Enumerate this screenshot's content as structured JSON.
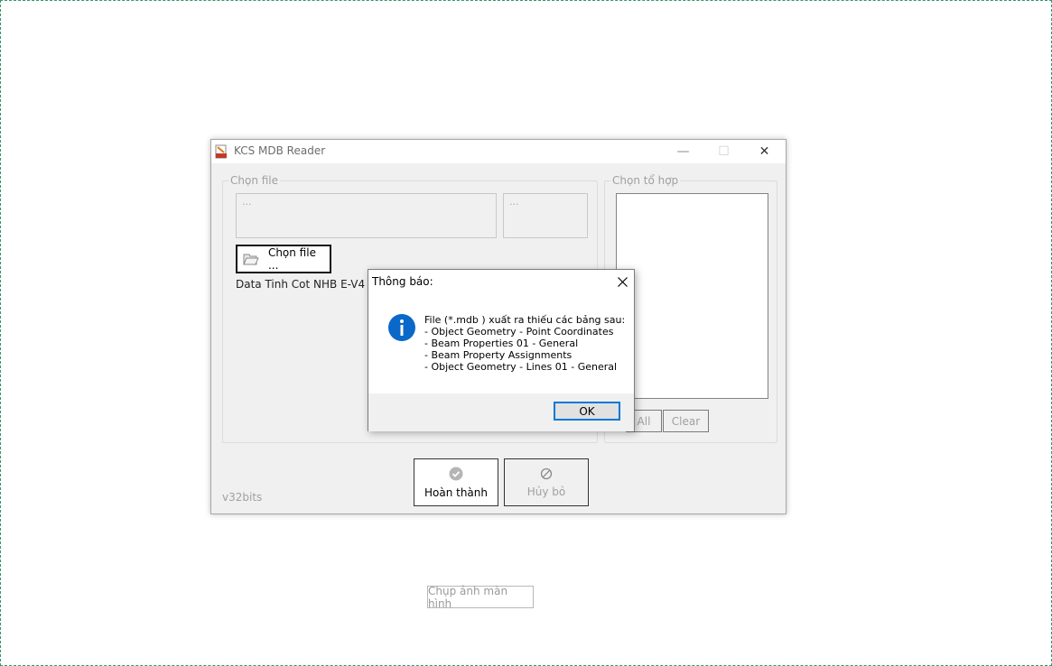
{
  "window": {
    "title": "KCS MDB Reader",
    "min_glyph": "—",
    "max_glyph": "☐",
    "close_glyph": "✕"
  },
  "file_group": {
    "label": "Chọn file",
    "path_placeholder": "...",
    "ext_placeholder": "...",
    "choose_button": "Chọn file ...",
    "data_text": "Data Tinh Cot NHB E-V4 23"
  },
  "combo_group": {
    "label": "Chọn tổ hợp",
    "all_button": "All",
    "clear_button": "Clear"
  },
  "footer": {
    "version": "v32bits",
    "done_button": "Hoàn thành",
    "cancel_button": "Hủy bỏ"
  },
  "message_box": {
    "title": "Thông báo:",
    "lines": [
      "File (*.mdb ) xuất ra thiếu các bảng sau:",
      "- Object Geometry - Point Coordinates",
      "- Beam Properties 01 - General",
      "- Beam Property Assignments",
      "- Object Geometry - Lines 01 - General"
    ],
    "ok_button": "OK",
    "icon": "info-icon"
  },
  "screenshot_button": "Chụp ảnh màn hình",
  "colors": {
    "accent": "#0078d7",
    "info_icon": "#0a68c8",
    "canvas_border": "#2e9a68"
  }
}
